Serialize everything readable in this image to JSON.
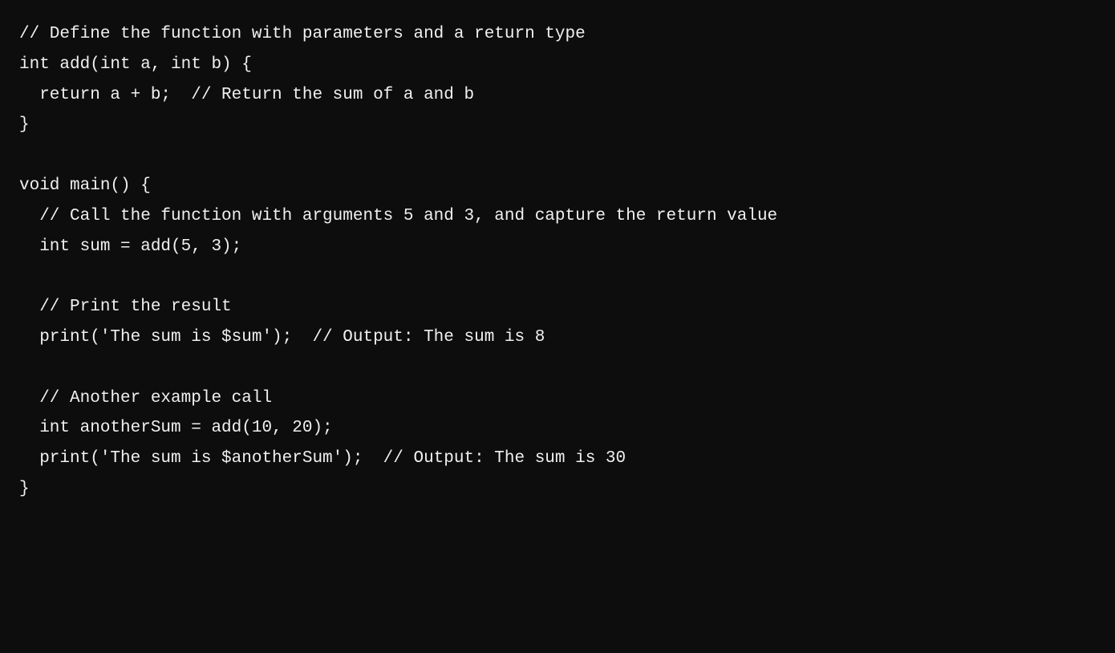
{
  "code": {
    "lines": [
      "// Define the function with parameters and a return type",
      "int add(int a, int b) {",
      "  return a + b;  // Return the sum of a and b",
      "}",
      "",
      "void main() {",
      "  // Call the function with arguments 5 and 3, and capture the return value",
      "  int sum = add(5, 3);",
      "",
      "  // Print the result",
      "  print('The sum is $sum');  // Output: The sum is 8",
      "",
      "  // Another example call",
      "  int anotherSum = add(10, 20);",
      "  print('The sum is $anotherSum');  // Output: The sum is 30",
      "}"
    ]
  }
}
